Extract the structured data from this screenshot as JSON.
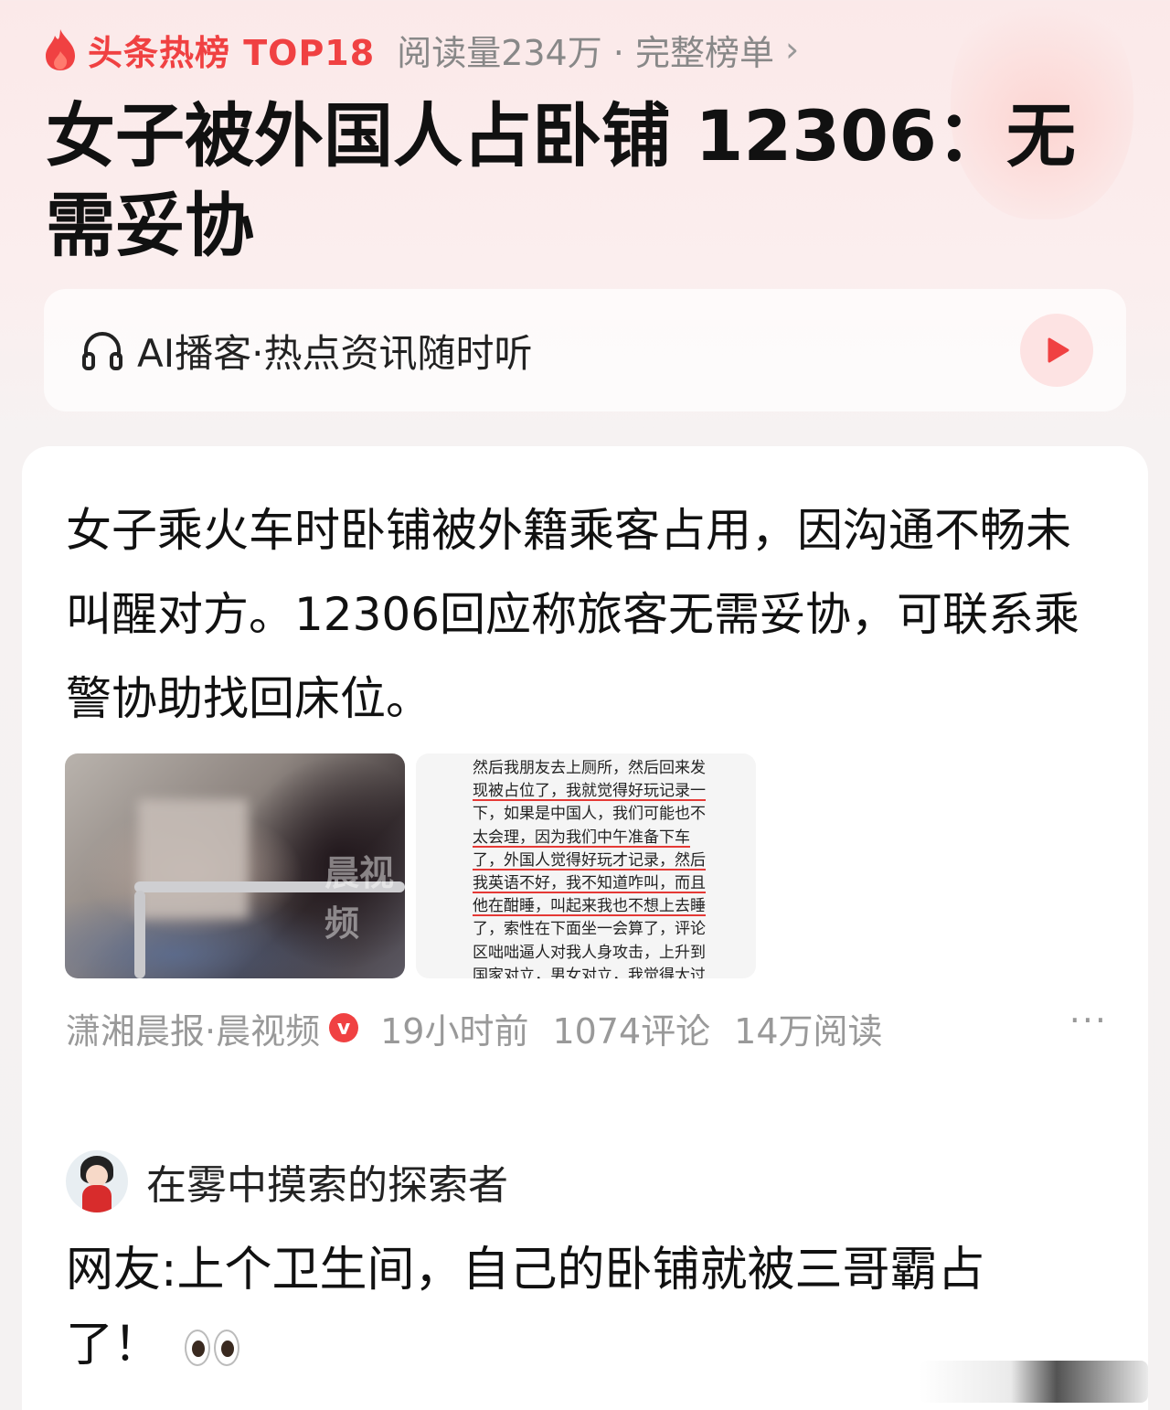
{
  "hot_list": {
    "label": "头条热榜 TOP18",
    "meta": "阅读量234万 · 完整榜单",
    "arrow": "›"
  },
  "headline": "女子被外国人占卧铺 12306：无需妥协",
  "podcast": {
    "label": "AI播客·热点资讯随时听"
  },
  "article": {
    "summary": "女子乘火车时卧铺被外籍乘客占用，因沟通不畅未叫醒对方。12306回应称旅客无需妥协，可联系乘警协助找回床位。",
    "photo_watermark": "晨视频",
    "screenshot_lines": [
      {
        "text": "然后我朋友去上厕所，然后回来发",
        "underline": false
      },
      {
        "text": "现被占位了，我就觉得好玩记录一",
        "underline": true
      },
      {
        "text": "下，如果是中国人，我们可能也不",
        "underline": false
      },
      {
        "text": "太会理，因为我们中午准备下车",
        "underline": true
      },
      {
        "text": "了，外国人觉得好玩才记录，然后",
        "underline": true
      },
      {
        "text": "我英语不好，我不知道咋叫，而且",
        "underline": true
      },
      {
        "text": "他在酣睡，叫起来我也不想上去睡",
        "underline": true
      },
      {
        "text": "了，索性在下面坐一会算了，评论",
        "underline": false
      },
      {
        "text": "区咄咄逼人对我人身攻击，上升到",
        "underline": false
      },
      {
        "text": "国家对立，男女对立，我觉得太过",
        "underline": false
      }
    ],
    "source": "潇湘晨报·晨视频",
    "verified_badge": "v",
    "time": "19小时前",
    "comments": "1074评论",
    "reads": "14万阅读",
    "more": "···"
  },
  "comment": {
    "username": "在雾中摸索的探索者",
    "text": "网友:上个卫生间，自己的卧铺就被三哥霸占了！"
  },
  "colors": {
    "accent": "#f04142",
    "meta_gray": "#999999"
  }
}
